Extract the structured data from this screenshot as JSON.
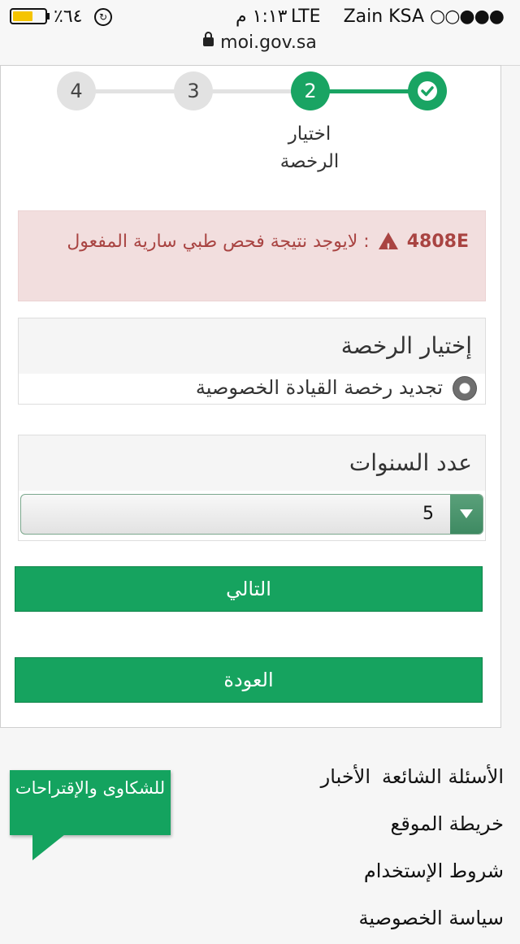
{
  "status_bar": {
    "signal_dots": "○○●●●",
    "carrier": "Zain KSA",
    "network": "LTE",
    "time": "١:١٣ م",
    "battery_pct": "٪٦٤",
    "battery_level": 0.64,
    "url": "moi.gov.sa"
  },
  "stepper": {
    "steps": [
      "4",
      "3",
      "2"
    ],
    "active_label": "اختيار الرخصة",
    "colors": {
      "done": "#19a463",
      "pending": "#e2e2e2"
    }
  },
  "alert": {
    "code": "4808E",
    "message": ": لايوجد نتيجة فحص طبي سارية المفعول"
  },
  "license_panel": {
    "title": "إختيار الرخصة",
    "option": "تجديد رخصة القيادة الخصوصية"
  },
  "years_panel": {
    "title": "عدد السنوات",
    "selected": "5"
  },
  "buttons": {
    "next": "التالي",
    "back": "العودة"
  },
  "footer": {
    "faq": "الأسئلة الشائعة",
    "news": "الأخبار",
    "sitemap": "خريطة الموقع",
    "terms": "شروط الإستخدام",
    "privacy": "سياسة الخصوصية",
    "complaints": "للشكاوى والإقتراحات"
  }
}
